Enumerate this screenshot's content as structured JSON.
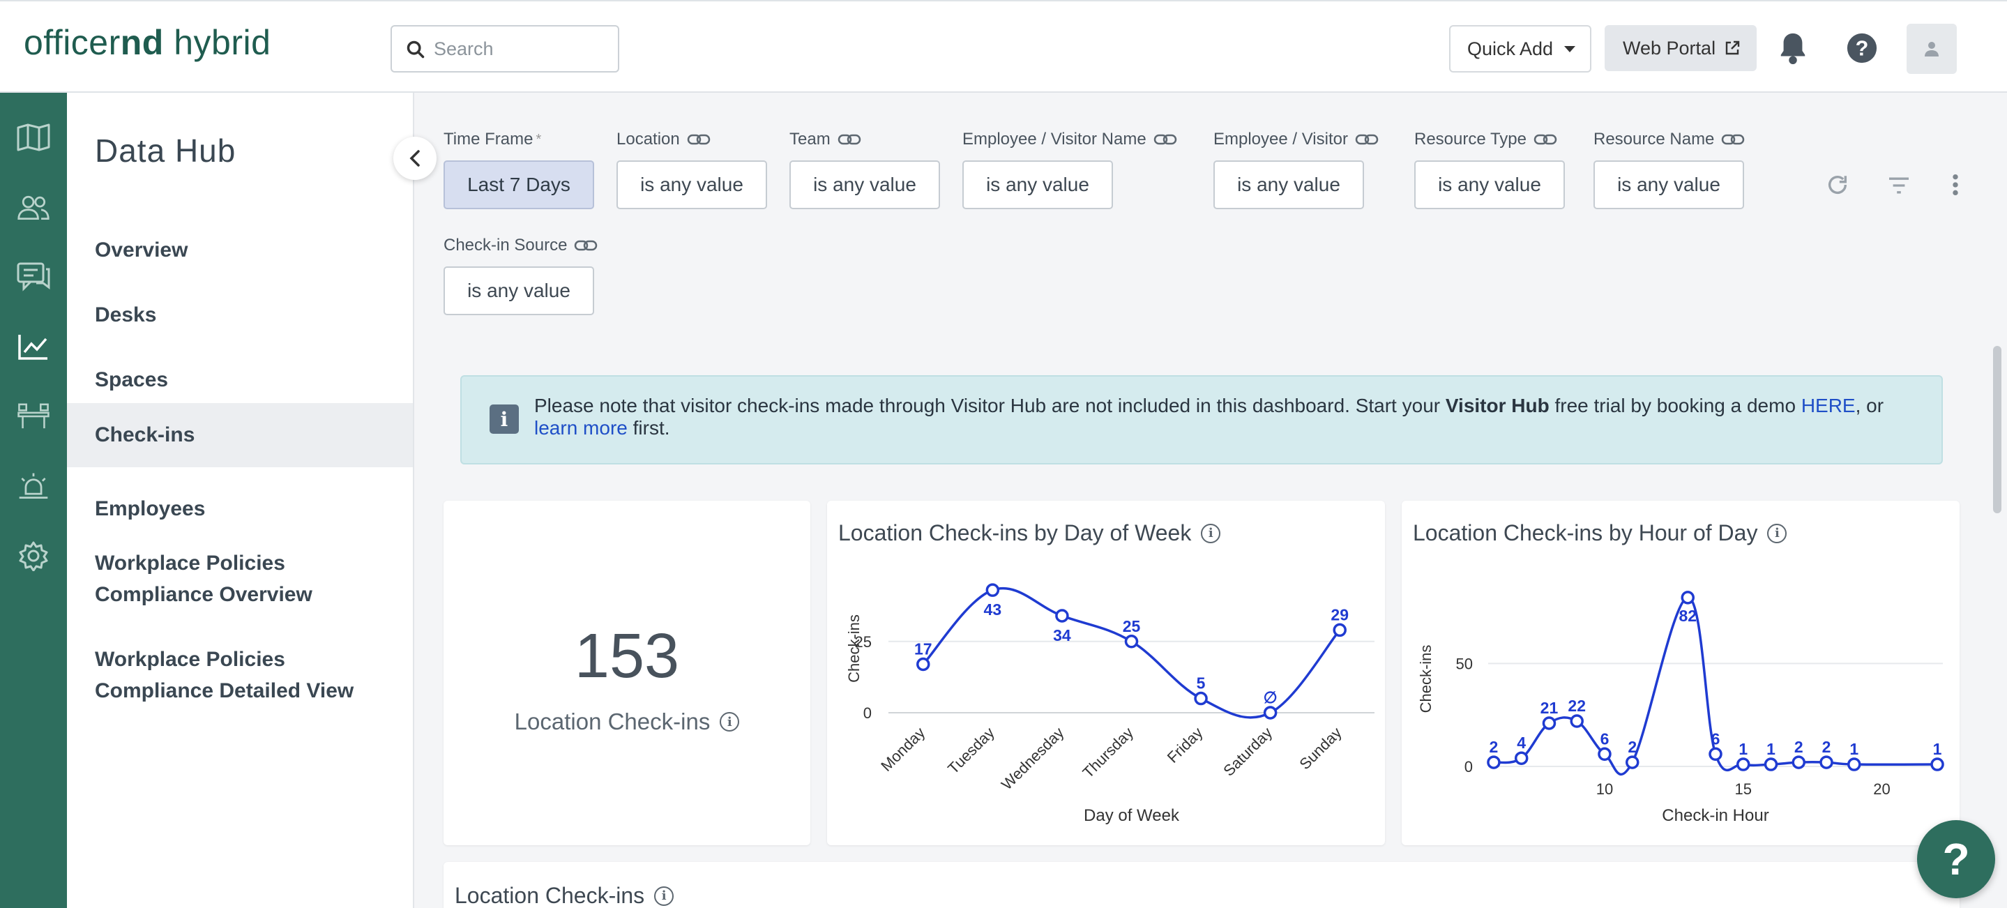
{
  "app": {
    "logo_light": "officer",
    "logo_bold": "nd",
    "logo_rest": " hybrid"
  },
  "topbar": {
    "search_placeholder": "Search",
    "quick_add": "Quick Add",
    "web_portal": "Web Portal"
  },
  "rail": {
    "icons": [
      "map-icon",
      "people-icon",
      "chat-icon",
      "analytics-icon",
      "desks-icon",
      "alert-icon",
      "settings-icon"
    ],
    "active": "analytics-icon"
  },
  "sidenav": {
    "title": "Data Hub",
    "items": [
      {
        "label": "Overview"
      },
      {
        "label": "Desks"
      },
      {
        "label": "Spaces"
      },
      {
        "label": "Check-ins",
        "active": true
      },
      {
        "label": "Employees"
      },
      {
        "label": "Workplace Policies\nCompliance Overview"
      },
      {
        "label": "Workplace Policies\nCompliance Detailed View"
      }
    ]
  },
  "filters": [
    {
      "label": "Time Frame",
      "required": true,
      "value": "Last 7 Days",
      "selected": true
    },
    {
      "label": "Location",
      "value": "is any value"
    },
    {
      "label": "Team",
      "value": "is any value"
    },
    {
      "label": "Employee / Visitor Name",
      "value": "is any value"
    },
    {
      "label": "Employee / Visitor",
      "value": "is any value"
    },
    {
      "label": "Resource Type",
      "value": "is any value"
    },
    {
      "label": "Resource Name",
      "value": "is any value"
    },
    {
      "label": "Check-in Source",
      "value": "is any value"
    }
  ],
  "required_marker": "*",
  "banner": {
    "text_1": "Please note that visitor check-ins made through Visitor Hub are not included in this dashboard. Start your ",
    "bold": "Visitor Hub",
    "text_2": " free trial by booking a demo ",
    "link_1": "HERE",
    "text_3": ", or",
    "link_2": "learn more",
    "text_4": " first."
  },
  "kpi": {
    "value": "153",
    "label": "Location Check-ins"
  },
  "charts_titles": {
    "day": "Location Check-ins by Day of Week",
    "hour": "Location Check-ins by Hour of Day",
    "bottom": "Location Check-ins"
  },
  "chart_data": [
    {
      "type": "line",
      "title": "Location Check-ins by Day of Week",
      "xlabel": "Day of Week",
      "ylabel": "Check-ins",
      "categories": [
        "Monday",
        "Tuesday",
        "Wednesday",
        "Thursday",
        "Friday",
        "Saturday",
        "Sunday"
      ],
      "values": [
        17,
        43,
        34,
        25,
        5,
        0,
        29
      ],
      "data_labels": [
        "17",
        "43",
        "34",
        "25",
        "5",
        "∅",
        "29"
      ],
      "yticks": [
        0,
        25
      ],
      "ylim": [
        0,
        45
      ],
      "color": "#1f3bd1",
      "grid": true
    },
    {
      "type": "line",
      "title": "Location Check-ins by Hour of Day",
      "xlabel": "Check-in Hour",
      "ylabel": "Check-ins",
      "x": [
        6,
        7,
        8,
        9,
        10,
        11,
        13,
        14,
        15,
        16,
        17,
        18,
        19,
        22
      ],
      "values": [
        2,
        4,
        21,
        22,
        6,
        2,
        82,
        6,
        1,
        1,
        2,
        2,
        1,
        1
      ],
      "xticks": [
        10,
        15,
        20
      ],
      "yticks": [
        0,
        50
      ],
      "xlim": [
        5.8,
        22.2
      ],
      "ylim": [
        0,
        85
      ],
      "color": "#1f3bd1",
      "grid": true
    }
  ],
  "colors": {
    "brand": "#2e6e5e",
    "line": "#1f3bd1",
    "banner_bg": "#d5ebee",
    "selected_filter": "#d7def0"
  }
}
